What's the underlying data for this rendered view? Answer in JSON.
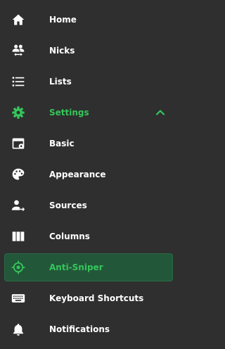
{
  "colors": {
    "background": "#2f2f2f",
    "text": "#ffffff",
    "accent": "#34c65a",
    "active_bg": "#23573a"
  },
  "nav": {
    "items": [
      {
        "label": "Home",
        "icon": "home-icon"
      },
      {
        "label": "Nicks",
        "icon": "nicks-users-swap-icon"
      },
      {
        "label": "Lists",
        "icon": "list-icon"
      },
      {
        "label": "Settings",
        "icon": "gear-icon",
        "expanded": true
      },
      {
        "label": "Basic",
        "icon": "window-gear-icon"
      },
      {
        "label": "Appearance",
        "icon": "palette-icon"
      },
      {
        "label": "Sources",
        "icon": "person-arrow-icon"
      },
      {
        "label": "Columns",
        "icon": "columns-icon"
      },
      {
        "label": "Anti-Sniper",
        "icon": "crosshair-icon",
        "active": true
      },
      {
        "label": "Keyboard Shortcuts",
        "icon": "keyboard-icon"
      },
      {
        "label": "Notifications",
        "icon": "bell-icon"
      }
    ]
  }
}
